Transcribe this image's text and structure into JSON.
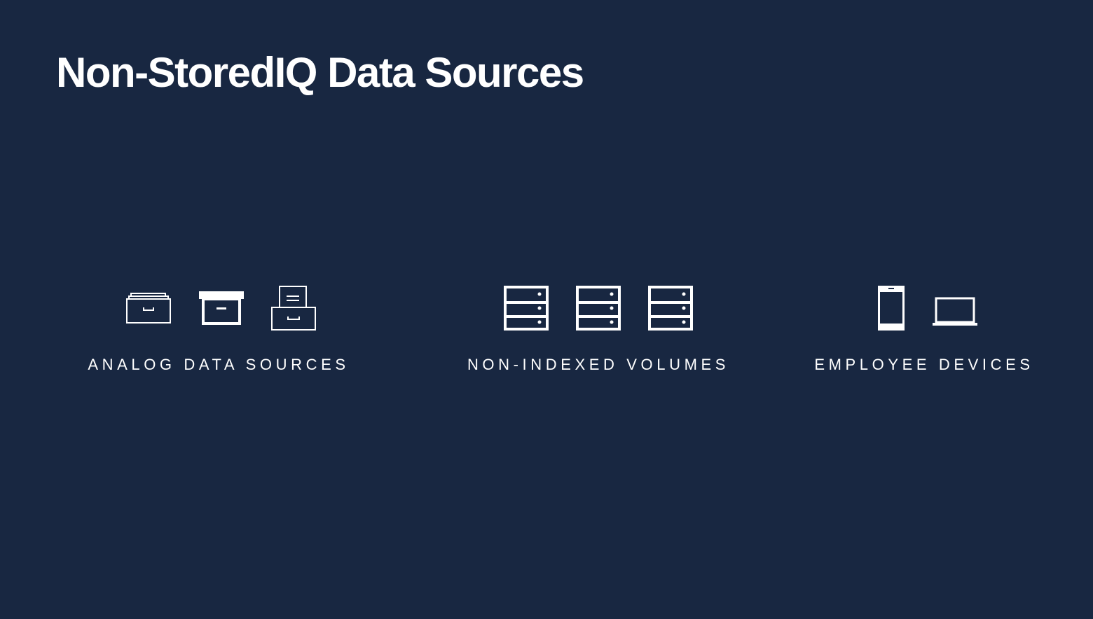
{
  "slide": {
    "title": "Non-StoredIQ Data Sources",
    "background_color": "#182741",
    "foreground_color": "#ffffff"
  },
  "groups": [
    {
      "label": "ANALOG DATA SOURCES",
      "icons": [
        "file-drawer-icon",
        "archive-box-icon",
        "document-tray-icon"
      ]
    },
    {
      "label": "NON-INDEXED VOLUMES",
      "icons": [
        "server-icon",
        "server-icon",
        "server-icon"
      ]
    },
    {
      "label": "EMPLOYEE DEVICES",
      "icons": [
        "smartphone-icon",
        "laptop-icon"
      ]
    }
  ]
}
